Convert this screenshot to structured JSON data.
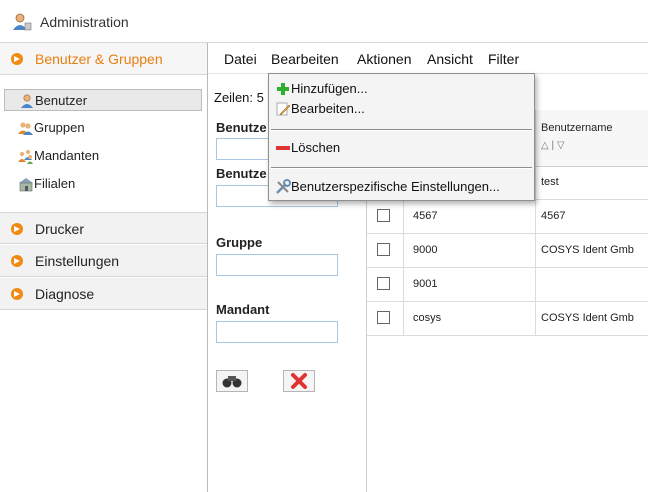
{
  "window": {
    "title": "Administration"
  },
  "sidebar": {
    "sections": [
      {
        "label": "Benutzer & Gruppen",
        "active": true
      },
      {
        "label": "Drucker"
      },
      {
        "label": "Einstellungen"
      },
      {
        "label": "Diagnose"
      }
    ],
    "items": [
      {
        "label": "Benutzer",
        "icon": "user-icon",
        "selected": true
      },
      {
        "label": "Gruppen",
        "icon": "group-icon"
      },
      {
        "label": "Mandanten",
        "icon": "clients-icon"
      },
      {
        "label": "Filialen",
        "icon": "branch-icon"
      }
    ]
  },
  "menubar": {
    "items": [
      "Datei",
      "Bearbeiten",
      "Aktionen",
      "Ansicht",
      "Filter"
    ]
  },
  "filter": {
    "rows_label": "Zeilen: 5",
    "labels": [
      "Benutze",
      "Benutze",
      "Gruppe",
      "Mandant"
    ]
  },
  "grid": {
    "header_col2": "Benutzername",
    "sort_glyphs": "△ | ▽",
    "rows": [
      {
        "id": "",
        "name": "test"
      },
      {
        "id": "4567",
        "name": "4567"
      },
      {
        "id": "9000",
        "name": "COSYS Ident Gmb"
      },
      {
        "id": "9001",
        "name": ""
      },
      {
        "id": "cosys",
        "name": "COSYS Ident Gmb"
      }
    ]
  },
  "dropdown": {
    "items": [
      "Hinzufügen...",
      "Bearbeiten...",
      "Löschen",
      "Benutzerspezifische Einstellungen..."
    ]
  },
  "colors": {
    "accent": "#f08a12",
    "input_border": "#a9c7e3",
    "delete_red": "#e03434",
    "add_green": "#2fae2f"
  }
}
